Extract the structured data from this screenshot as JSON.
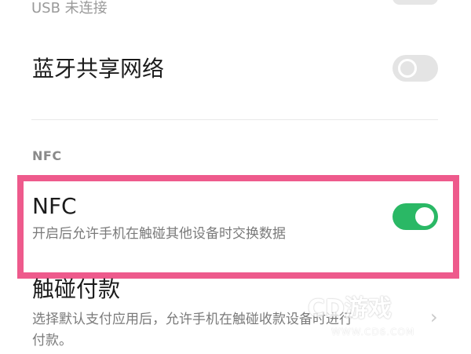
{
  "usb_row": {
    "subtitle": "USB 未连接"
  },
  "bluetooth_tethering": {
    "title": "蓝牙共享网络",
    "toggle_state": "off"
  },
  "nfc_section": {
    "header": "NFC"
  },
  "nfc_row": {
    "title": "NFC",
    "subtitle": "开启后允许手机在触碰其他设备时交换数据",
    "toggle_state": "on"
  },
  "tap_to_pay_row": {
    "title": "触碰付款",
    "subtitle_line1": "选择默认支付应用后，允许手机在触碰收款设备时进行",
    "subtitle_line2": "付款。",
    "chevron": "›"
  },
  "watermark": {
    "brand": "CD游戏",
    "url": "WWW.CD6.COM"
  },
  "colors": {
    "toggle_on": "#2ab865",
    "toggle_off": "#e4e4e4",
    "highlight_border": "#ee5a8c"
  }
}
